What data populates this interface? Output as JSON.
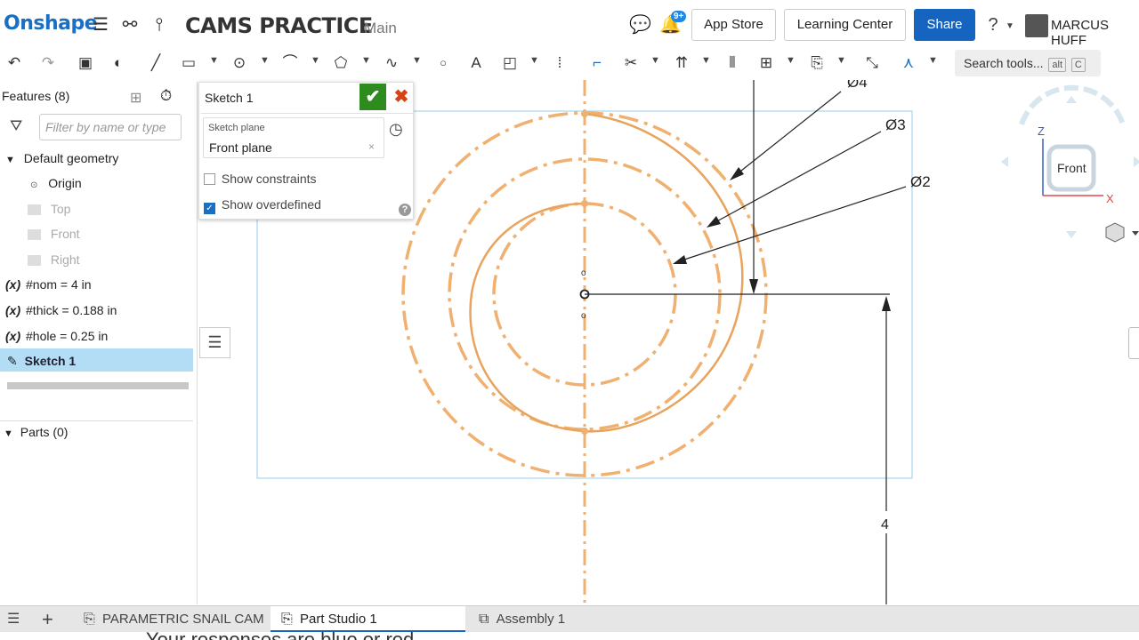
{
  "header": {
    "logo": "Onshape",
    "doc_title": "CAMS PRACTICE",
    "branch": "Main",
    "notif_badge": "9+",
    "app_store": "App Store",
    "learning_center": "Learning Center",
    "share": "Share",
    "user": "MARCUS HUFF"
  },
  "toolbar": {
    "search_label": "Search tools...",
    "shortcut_1": "alt",
    "shortcut_2": "C"
  },
  "features": {
    "header": "Features (8)",
    "filter_placeholder": "Filter by name or type",
    "default_geometry": "Default geometry",
    "origin": "Origin",
    "top": "Top",
    "front": "Front",
    "right": "Right",
    "var1": "#nom = 4 in",
    "var2": "#thick = 0.188 in",
    "var3": "#hole = 0.25 in",
    "sketch": "Sketch 1",
    "parts": "Parts (0)"
  },
  "sketch_dialog": {
    "title": "Sketch 1",
    "plane_label": "Sketch plane",
    "plane_value": "Front plane",
    "show_constraints": "Show constraints",
    "show_constraints_checked": false,
    "show_overdefined": "Show overdefined",
    "show_overdefined_checked": true
  },
  "canvas": {
    "dim_d4": "Ø4",
    "dim_d3": "Ø3",
    "dim_d2": "Ø2",
    "dim_4": "4"
  },
  "viewcube": {
    "face": "Front",
    "axis_z": "Z",
    "axis_x": "X"
  },
  "tabs": [
    {
      "label": "PARAMETRIC SNAIL CAM",
      "active": false
    },
    {
      "label": "Part Studio 1",
      "active": true
    },
    {
      "label": "Assembly 1",
      "active": false
    }
  ],
  "caption": "Your responses are blue or red",
  "colors": {
    "accent": "#1565c0",
    "sketch_orange": "#f0b070",
    "selection_blue": "#b3dcf5"
  }
}
